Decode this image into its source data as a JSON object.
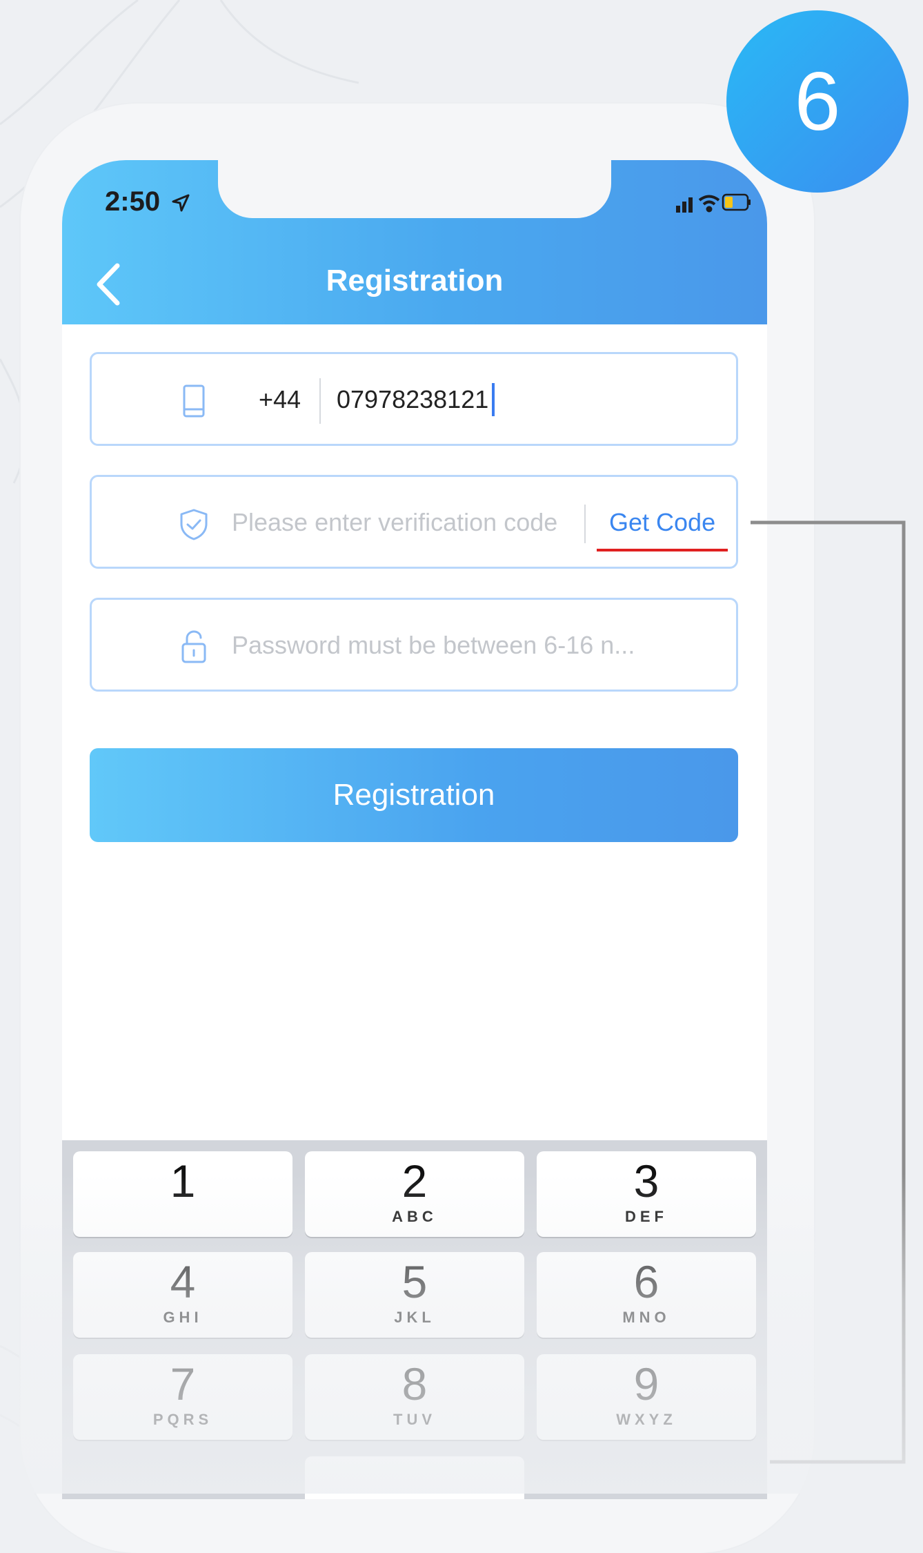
{
  "step_badge": "6",
  "status_bar": {
    "time": "2:50"
  },
  "nav": {
    "title": "Registration"
  },
  "phone_field": {
    "country_code": "+44",
    "value": "07978238121"
  },
  "code_field": {
    "placeholder": "Please enter verification code",
    "get_code": "Get Code"
  },
  "password_field": {
    "placeholder": "Password must be between 6-16 n..."
  },
  "register_button": {
    "label": "Registration"
  },
  "keyboard": {
    "keys": [
      {
        "digit": "1",
        "letters": ""
      },
      {
        "digit": "2",
        "letters": "ABC"
      },
      {
        "digit": "3",
        "letters": "DEF"
      },
      {
        "digit": "4",
        "letters": "GHI"
      },
      {
        "digit": "5",
        "letters": "JKL"
      },
      {
        "digit": "6",
        "letters": "MNO"
      },
      {
        "digit": "7",
        "letters": "PQRS"
      },
      {
        "digit": "8",
        "letters": "TUV"
      },
      {
        "digit": "9",
        "letters": "WXYZ"
      }
    ]
  },
  "colors": {
    "accent": "#3a86f0",
    "header_start": "#5ec7f9",
    "header_end": "#4a98ea",
    "highlight": "#e02020"
  }
}
